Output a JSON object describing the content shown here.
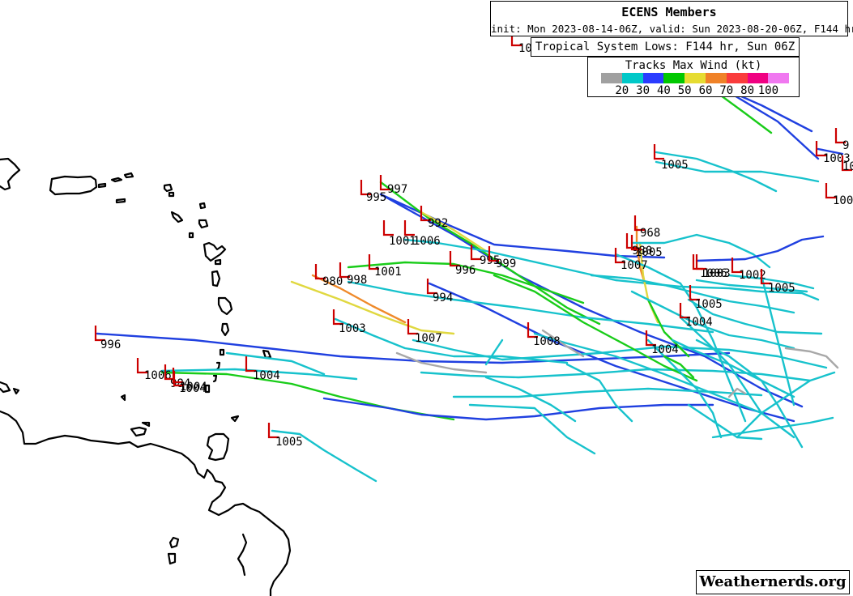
{
  "title": "ECENS Members",
  "subtitle": "init: Mon 2023-08-14-06Z, valid: Sun 2023-08-20-06Z, F144 hr",
  "lows_label": "Tropical System Lows: F144 hr, Sun 06Z",
  "legend": {
    "title": "Tracks Max Wind (kt)",
    "ticks": [
      "20",
      "30",
      "40",
      "50",
      "60",
      "70",
      "80",
      "100"
    ],
    "colors": [
      "#a0a0a0",
      "#00c8c8",
      "#2a3cff",
      "#00c800",
      "#e6dc32",
      "#f08228",
      "#fa3c3c",
      "#f00082",
      "#f078f0"
    ]
  },
  "credit": "Weathernerds.org",
  "pressure_labels": [
    "1005",
    "9",
    "1003",
    "100",
    "1005",
    "995",
    "997",
    "992",
    "1001",
    "1006",
    "968",
    "980",
    "1005",
    "1007",
    "996",
    "995",
    "999",
    "1006",
    "1003",
    "1003",
    "1002",
    "1005",
    "980",
    "998",
    "1001",
    "994",
    "1005",
    "1004",
    "1004",
    "996",
    "1003",
    "1007",
    "1008",
    "1004",
    "1006",
    "984",
    "1004",
    "1004",
    "1005"
  ],
  "track_colors": {
    "gray": "#a8a8a8",
    "cyan": "#17c2cc",
    "blue": "#2040e0",
    "green": "#19cc19",
    "yellow": "#e0d840",
    "orange": "#ef8a2a"
  }
}
